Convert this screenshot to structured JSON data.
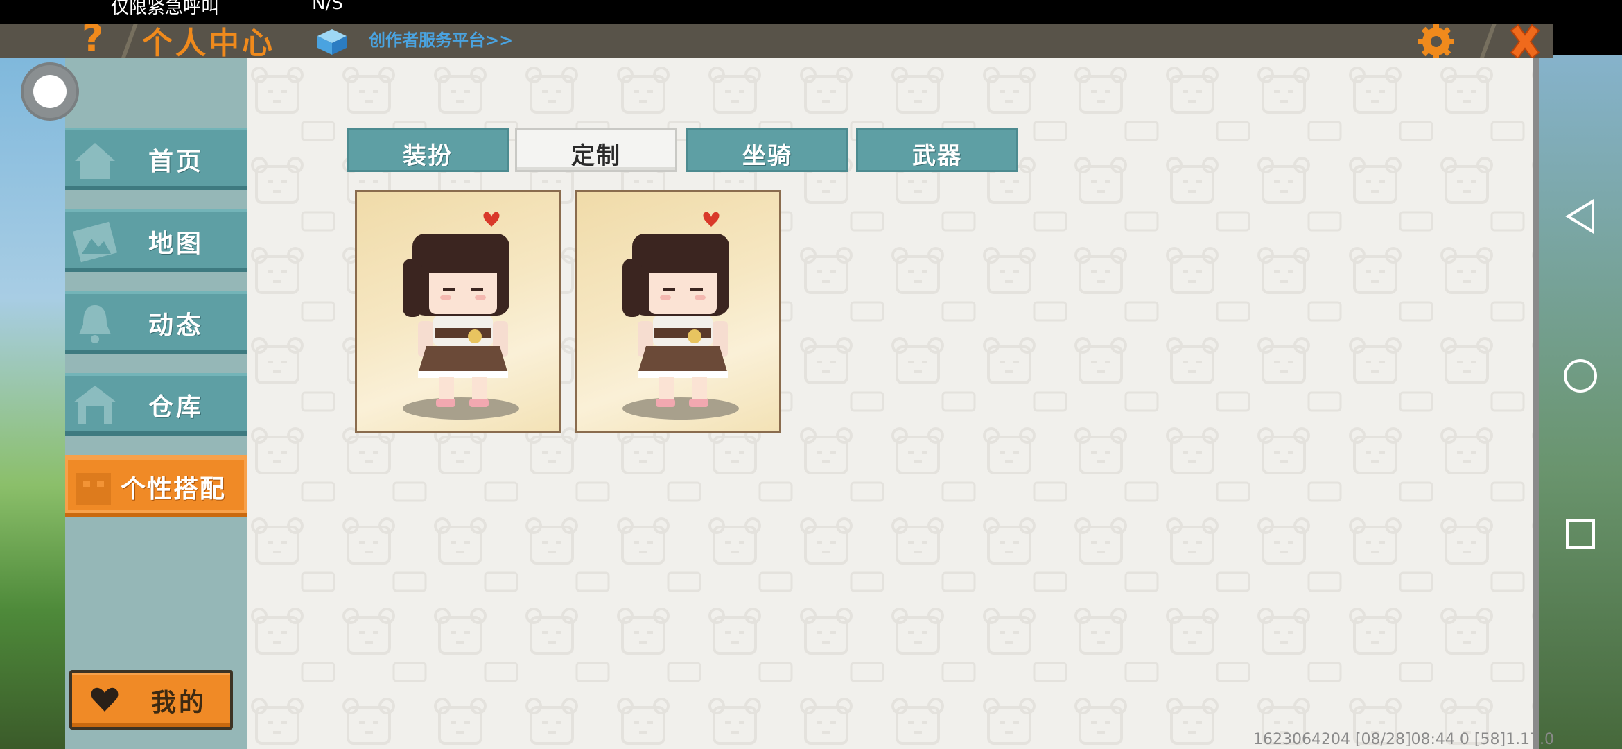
{
  "status_bar": {
    "left_text": "仅限紧急呼叫",
    "mid_text": "N/S"
  },
  "header": {
    "title": "个人中心",
    "platform_link": "创作者服务平台>>"
  },
  "sidebar": {
    "items": [
      {
        "label": "首页",
        "icon": "house-icon"
      },
      {
        "label": "地图",
        "icon": "map-icon"
      },
      {
        "label": "动态",
        "icon": "bell-icon"
      },
      {
        "label": "仓库",
        "icon": "warehouse-icon"
      },
      {
        "label": "个性搭配",
        "icon": "outfit-icon",
        "active": true
      }
    ],
    "my_button": "我的"
  },
  "tabs": [
    {
      "label": "装扮",
      "selected": false
    },
    {
      "label": "定制",
      "selected": true
    },
    {
      "label": "坐骑",
      "selected": false
    },
    {
      "label": "武器",
      "selected": false
    }
  ],
  "cards": [
    {
      "name": "character-skin-1"
    },
    {
      "name": "character-skin-2"
    }
  ],
  "footer": {
    "version": "1623064204    [08/28]08:44 0   [58]1.17.0"
  },
  "colors": {
    "accent_orange": "#f08a26",
    "teal": "#5e9fa4",
    "header_bg": "#585349",
    "link_blue": "#4aa3e0"
  }
}
